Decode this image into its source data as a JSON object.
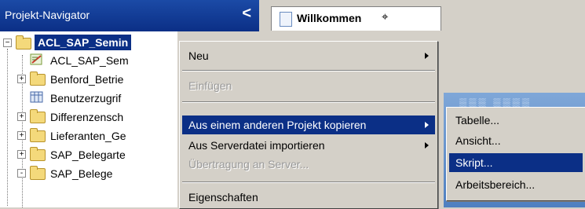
{
  "navigator": {
    "title": "Projekt-Navigator",
    "collapse_glyph": "<"
  },
  "tree": {
    "root_label": "ACL_SAP_Semin",
    "items": [
      {
        "label": "ACL_SAP_Sem",
        "icon": "script-icon",
        "toggle": ""
      },
      {
        "label": "Benford_Betrie",
        "icon": "folder-icon",
        "toggle": "+"
      },
      {
        "label": "Benutzerzugrif",
        "icon": "table-icon",
        "toggle": ""
      },
      {
        "label": "Differenzensch",
        "icon": "folder-icon",
        "toggle": "+"
      },
      {
        "label": "Lieferanten_Ge",
        "icon": "folder-icon",
        "toggle": "+"
      },
      {
        "label": "SAP_Belegarte",
        "icon": "folder-icon",
        "toggle": "+"
      },
      {
        "label": "SAP_Belege",
        "icon": "folder-open-icon",
        "toggle": "-"
      }
    ]
  },
  "tabs": [
    {
      "label": "Willkommen",
      "pin_glyph": "⌖"
    }
  ],
  "context_menu": {
    "items": [
      {
        "label": "Neu",
        "submenu": true,
        "disabled": false
      },
      {
        "label": "Einfügen",
        "submenu": false,
        "disabled": true
      },
      {
        "label": "Aus einem anderen Projekt kopieren",
        "submenu": true,
        "disabled": false,
        "highlighted": true
      },
      {
        "label": "Aus Serverdatei importieren",
        "submenu": true,
        "disabled": false
      },
      {
        "label": "Übertragung an Server...",
        "submenu": false,
        "disabled": true
      },
      {
        "label": "Eigenschaften",
        "submenu": false,
        "disabled": false
      }
    ]
  },
  "submenu": {
    "items": [
      {
        "label": "Tabelle...",
        "highlighted": false
      },
      {
        "label": "Ansicht...",
        "highlighted": false
      },
      {
        "label": "Skript...",
        "highlighted": true
      },
      {
        "label": "Arbeitsbereich...",
        "highlighted": false
      }
    ]
  },
  "colors": {
    "selection": "#0b2f86",
    "menu_bg": "#d4d0c8",
    "header_bg": "#1b4aa6"
  }
}
